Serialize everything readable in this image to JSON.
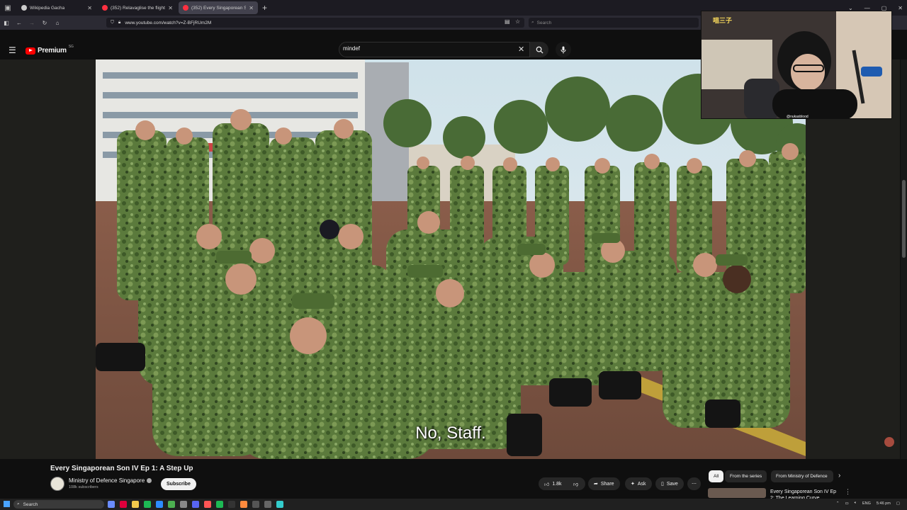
{
  "browser": {
    "tabs": [
      {
        "label": "Wikipedia Gacha",
        "favicon_color": "#cccccc",
        "active": false
      },
      {
        "label": "(352) Relavaglise the flight",
        "favicon_color": "#ff3040",
        "active": false
      },
      {
        "label": "(352) Every Singaporean So",
        "favicon_color": "#ff3040",
        "active": true
      }
    ],
    "url": "www.youtube.com/watch?v=Z-BFjRUm2M",
    "search_placeholder": "Search"
  },
  "youtube": {
    "logo_text": "Premium",
    "logo_region": "SG",
    "search_query": "mindef",
    "subtitle": "No, Staff.",
    "video_title": "Every Singaporean Son IV Ep 1: A Step Up",
    "channel": {
      "name": "Ministry of Defence Singapore",
      "subscribers": "108k subscribers"
    },
    "subscribe_label": "Subscribe",
    "actions": {
      "likes": "1.8k",
      "share": "Share",
      "ask": "Ask",
      "save": "Save",
      "more": "⋯"
    },
    "chips": [
      "All",
      "From the series",
      "From Ministry of Defence"
    ],
    "recommendation": {
      "title": "Every Singaporean Son IV Ep 2: The Learning Curve",
      "menu": "⋮"
    }
  },
  "webcam": {
    "handle": "@nukasblood",
    "sign_text": "喵三子"
  },
  "taskbar": {
    "search_placeholder": "Search",
    "lang": "ENG",
    "time": "5:46 pm"
  },
  "colors": {
    "brand": "#ff0000",
    "background": "#0f0f0f"
  }
}
